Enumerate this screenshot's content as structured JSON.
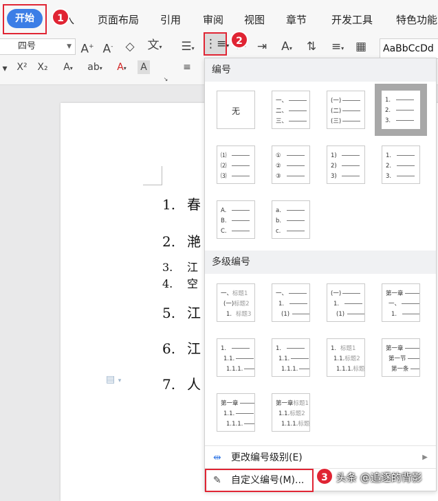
{
  "ribbon": {
    "start_label": "开始",
    "tabs": [
      "入",
      "页面布局",
      "引用",
      "审阅",
      "视图",
      "章节",
      "开发工具",
      "特色功能"
    ],
    "font_size": "四号",
    "style_preview": "AaBbCcDd",
    "badges": [
      "1",
      "2",
      "3"
    ]
  },
  "document": {
    "items": [
      {
        "num": "1.",
        "text": "春"
      },
      {
        "num": "2.",
        "text": "滟"
      },
      {
        "num": "3.",
        "text": "江"
      },
      {
        "num": "4.",
        "text": "空"
      },
      {
        "num": "5.",
        "text": "江"
      },
      {
        "num": "6.",
        "text": "江"
      },
      {
        "num": "7.",
        "text": "人"
      }
    ]
  },
  "numbering_panel": {
    "section_numbering": "编号",
    "section_multilevel": "多级编号",
    "none_label": "无",
    "cells_single": [
      [
        [
          "一、",
          "二、",
          "三、"
        ]
      ],
      [
        [
          "(一)",
          "(二)",
          "(三)"
        ]
      ],
      [
        [
          "1.",
          "2.",
          "3."
        ]
      ],
      [
        [
          "⑴",
          "⑵",
          "⑶"
        ]
      ],
      [
        [
          "①",
          "②",
          "③"
        ]
      ],
      [
        [
          "1)",
          "2)",
          "3)"
        ]
      ],
      [
        [
          "1.",
          "2.",
          "3."
        ]
      ],
      [
        [
          "A.",
          "B.",
          "C."
        ]
      ],
      [
        [
          "a.",
          "b.",
          "c."
        ]
      ]
    ],
    "multilevel_cells": [
      [
        [
          "一、",
          "标题1"
        ],
        [
          "(一)",
          "标题2"
        ],
        [
          "1.",
          "标题3"
        ]
      ],
      [
        [
          "一、",
          ""
        ],
        [
          "1.",
          ""
        ],
        [
          "(1)",
          ""
        ]
      ],
      [
        [
          "(一)",
          ""
        ],
        [
          "1.",
          ""
        ],
        [
          "(1)",
          ""
        ]
      ],
      [
        [
          "第一章",
          ""
        ],
        [
          "一、",
          ""
        ],
        [
          "1.",
          ""
        ]
      ],
      [
        [
          "1.",
          ""
        ],
        [
          "1.1.",
          ""
        ],
        [
          "1.1.1.",
          ""
        ]
      ],
      [
        [
          "1.",
          ""
        ],
        [
          "1.1.",
          ""
        ],
        [
          "1.1.1.",
          ""
        ]
      ],
      [
        [
          "1.",
          "标题1"
        ],
        [
          "1.1.",
          "标题2"
        ],
        [
          "1.1.1.",
          "标题3"
        ]
      ],
      [
        [
          "第一章",
          ""
        ],
        [
          "第一节",
          ""
        ],
        [
          "第一条",
          ""
        ]
      ],
      [
        [
          "第一章",
          ""
        ],
        [
          "1.1.",
          ""
        ],
        [
          "1.1.1.",
          ""
        ]
      ],
      [
        [
          "第一章",
          "标题1"
        ],
        [
          "1.1.",
          "标题2"
        ],
        [
          "1.1.1.",
          "标题3"
        ]
      ]
    ],
    "change_level_label": "更改编号级别(E)",
    "custom_label": "自定义编号(M)..."
  },
  "watermark": "头条 @追逐的背影",
  "colors": {
    "accent": "#3c7ee6",
    "highlight": "#e02433"
  }
}
